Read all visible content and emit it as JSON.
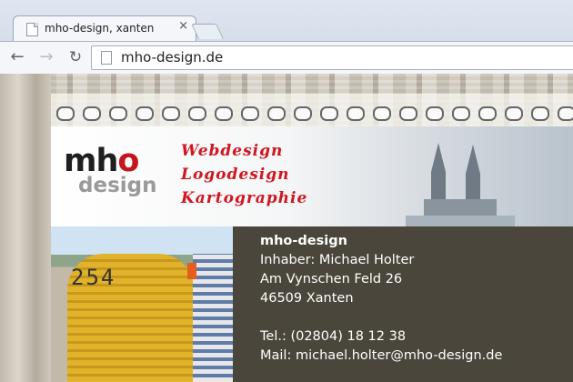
{
  "browser": {
    "tab": {
      "title": "mho-design, xanten",
      "close_glyph": "×"
    },
    "nav": {
      "back_glyph": "←",
      "forward_glyph": "→",
      "reload_glyph": "↻"
    },
    "address": {
      "url": "mho-design.de"
    }
  },
  "site": {
    "logo": {
      "main": "mh",
      "dot": "o",
      "sub": "design"
    },
    "services": [
      "Webdesign",
      "Logodesign",
      "Kartographie"
    ],
    "photo": {
      "chair_number": "254"
    },
    "contact": {
      "company": "mho-design",
      "owner": "Inhaber: Michael Holter",
      "street": "Am Vynschen Feld 26",
      "city": "46509 Xanten",
      "phone": "Tel.: (02804) 18 12 38",
      "email": "Mail: michael.holter@mho-design.de"
    }
  },
  "colors": {
    "accent_red": "#d0161f",
    "contact_bg": "#4a463b"
  }
}
